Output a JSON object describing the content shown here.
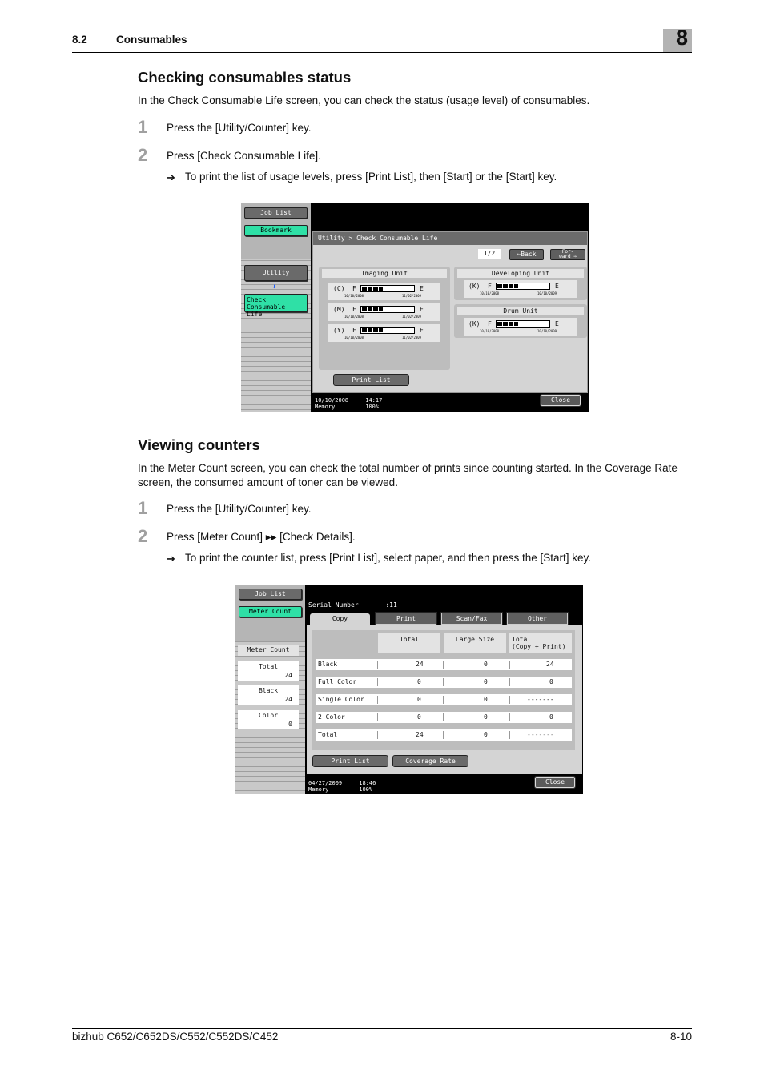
{
  "header": {
    "section_number": "8.2",
    "section_title": "Consumables",
    "chapter": "8"
  },
  "section1": {
    "title": "Checking consumables status",
    "intro": "In the Check Consumable Life screen, you can check the status (usage level) of consumables.",
    "steps": [
      {
        "num": "1",
        "text": "Press the [Utility/Counter] key."
      },
      {
        "num": "2",
        "text": "Press [Check Consumable Life]."
      }
    ],
    "sub_arrow": "➔",
    "sub_step": "To print the list of usage levels, press [Print List], then [Start] or the [Start] key."
  },
  "screen1": {
    "sidebar": {
      "job_list": "Job List",
      "bookmark": "Bookmark",
      "utility": "Utility",
      "arrow": "⬇",
      "current": "Check Consumable\nLife"
    },
    "breadcrumb": "Utility > Check Consumable Life",
    "page_indicator": "1/2",
    "back_label": "⇐Back",
    "forward_label": "For-\nward ⇒",
    "imaging_unit": {
      "title": "Imaging Unit",
      "items": [
        {
          "label": "(C)",
          "f": "F",
          "e": "E",
          "level": 0.4,
          "date1": "10/10/2008",
          "date2": "11/02/2009"
        },
        {
          "label": "(M)",
          "f": "F",
          "e": "E",
          "level": 0.4,
          "date1": "10/10/2008",
          "date2": "11/02/2009"
        },
        {
          "label": "(Y)",
          "f": "F",
          "e": "E",
          "level": 0.4,
          "date1": "10/10/2008",
          "date2": "11/02/2009"
        }
      ]
    },
    "developing_unit": {
      "title": "Developing Unit",
      "items": [
        {
          "label": "(K)",
          "f": "F",
          "e": "E",
          "level": 0.4,
          "date1": "10/10/2008",
          "date2": "10/10/2009"
        }
      ]
    },
    "drum_unit": {
      "title": "Drum Unit",
      "items": [
        {
          "label": "(K)",
          "f": "F",
          "e": "E",
          "level": 0.4,
          "date1": "10/10/2008",
          "date2": "10/10/2009"
        }
      ]
    },
    "print_list": "Print List",
    "status_date": "10/10/2008",
    "status_time": "14:17",
    "memory_label": "Memory",
    "memory_value": "100%",
    "close": "Close"
  },
  "section2": {
    "title": "Viewing counters",
    "intro": "In the Meter Count screen, you can check the total number of prints since counting started. In the Coverage Rate screen, the consumed amount of toner can be viewed.",
    "steps": [
      {
        "num": "1",
        "text": "Press the [Utility/Counter] key."
      },
      {
        "num": "2",
        "text": "Press [Meter Count] ▸▸ [Check Details]."
      }
    ],
    "sub_arrow": "➔",
    "sub_step": "To print the counter list, press [Print List], select paper, and then press the [Start] key."
  },
  "screen2": {
    "sidebar": {
      "job_list": "Job List",
      "meter_count_btn": "Meter Count",
      "meter_count_label": "Meter Count",
      "cards": [
        {
          "title": "Total",
          "value": "24"
        },
        {
          "title": "Black",
          "value": "24"
        },
        {
          "title": "Color",
          "value": "0"
        }
      ]
    },
    "serial_label": "Serial Number",
    "serial_value": ":11",
    "tabs": [
      "Copy",
      "Print",
      "Scan/Fax",
      "Other"
    ],
    "active_tab": "Copy",
    "columns": [
      "Total",
      "Large Size",
      "Total\n(Copy + Print)"
    ],
    "rows": [
      {
        "label": "Black",
        "values": [
          "24",
          "0",
          "24"
        ]
      },
      {
        "label": "Full Color",
        "values": [
          "0",
          "0",
          "0"
        ]
      },
      {
        "label": "Single Color",
        "values": [
          "0",
          "0",
          "-------"
        ]
      },
      {
        "label": "2 Color",
        "values": [
          "0",
          "0",
          "0"
        ]
      },
      {
        "label": "Total",
        "values": [
          "24",
          "0",
          "-------"
        ]
      }
    ],
    "print_list": "Print List",
    "coverage_rate": "Coverage Rate",
    "status_date": "04/27/2009",
    "status_time": "18:46",
    "memory_label": "Memory",
    "memory_value": "100%",
    "close": "Close"
  },
  "footer": {
    "model": "bizhub C652/C652DS/C552/C552DS/C452",
    "page": "8-10"
  }
}
